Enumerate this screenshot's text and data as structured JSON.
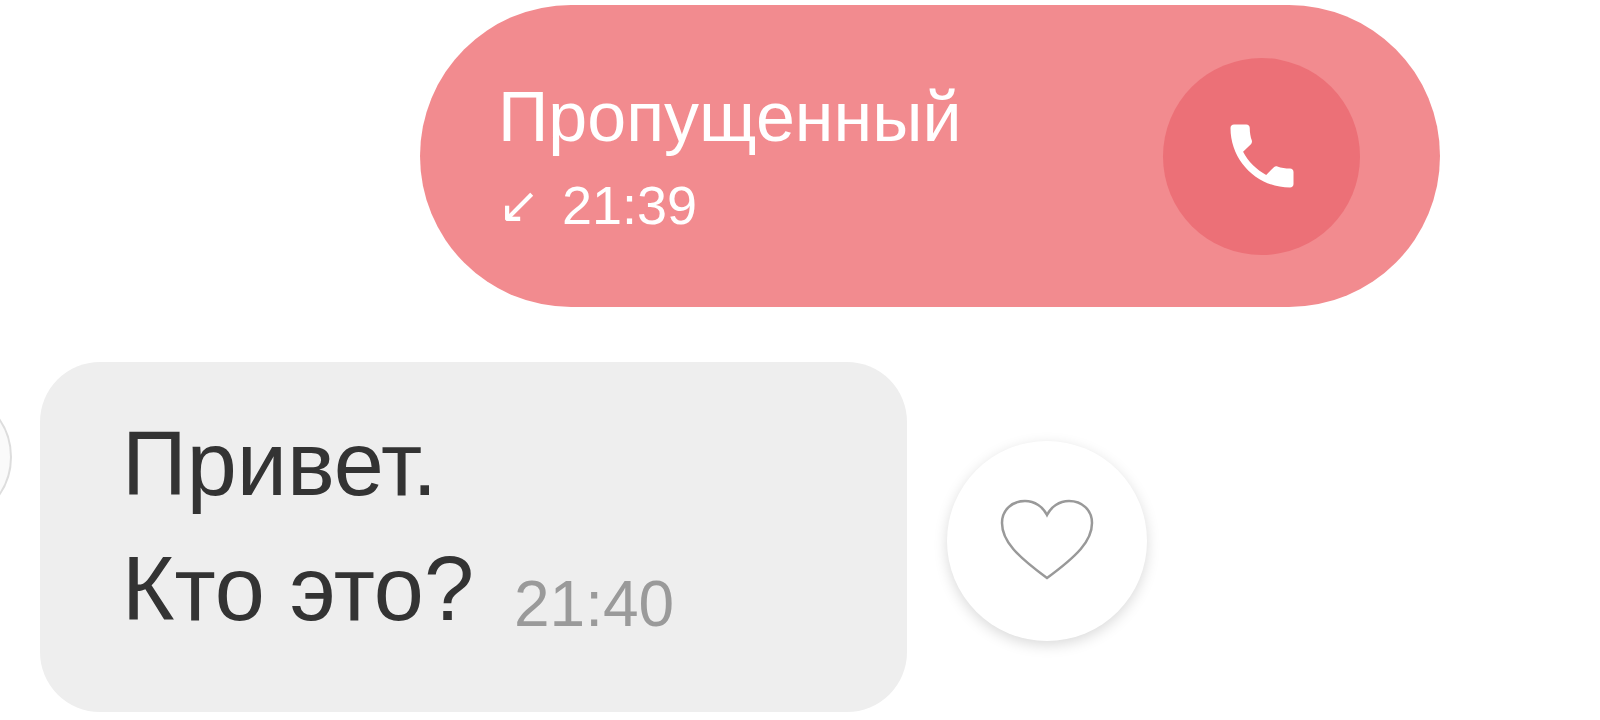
{
  "messages": [
    {
      "kind": "missed_call",
      "title": "Пропущенный",
      "direction_icon": "↙",
      "time": "21:39"
    },
    {
      "kind": "text",
      "text": "Привет.\nКто это?",
      "time": "21:40",
      "liked": false
    }
  ]
}
